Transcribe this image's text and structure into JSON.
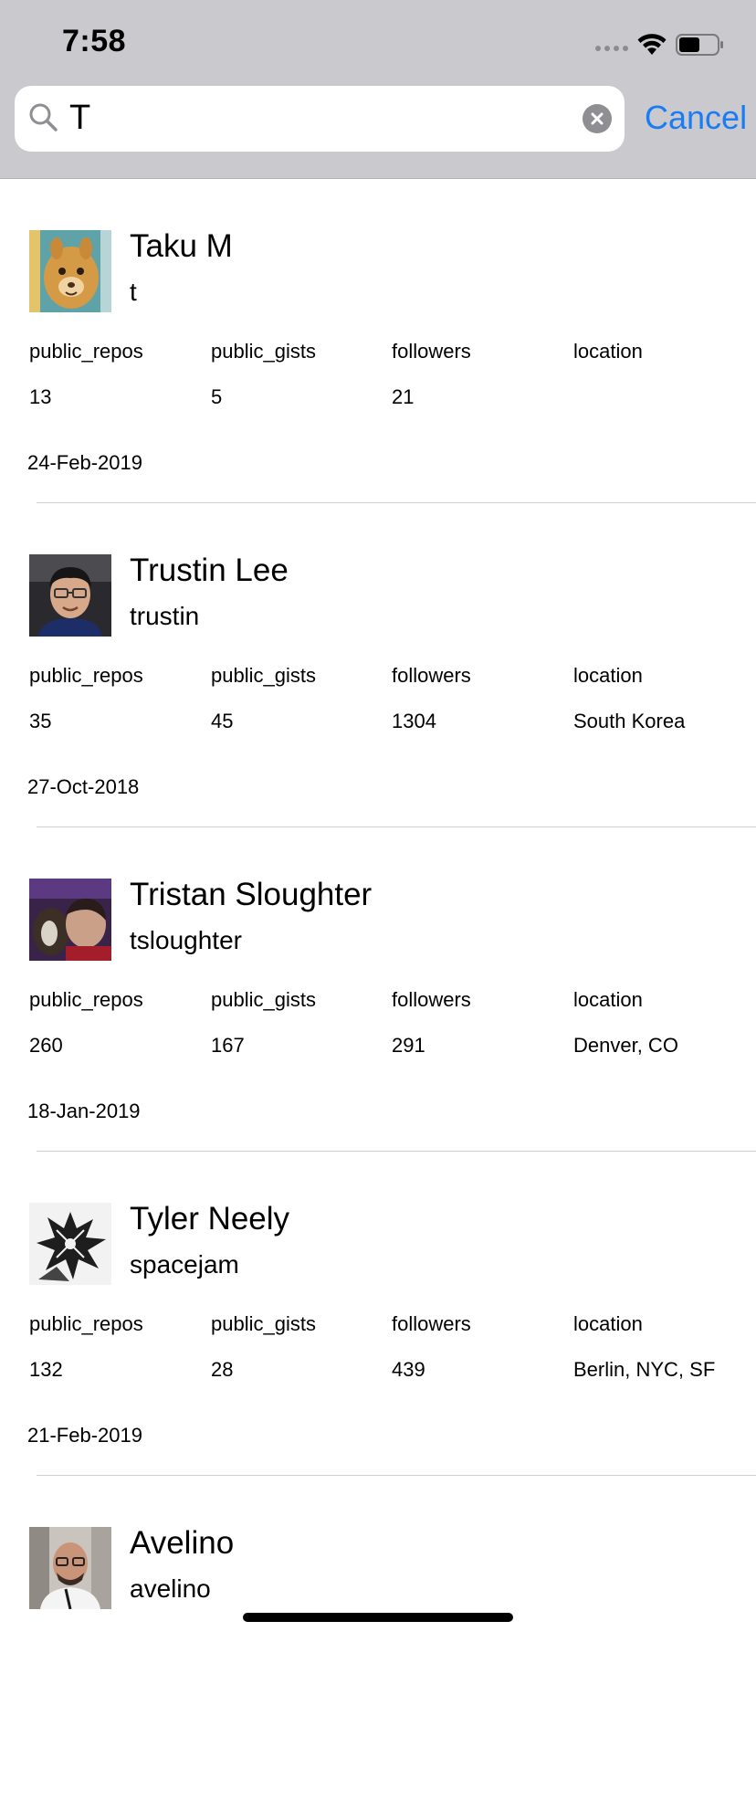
{
  "status_bar": {
    "time": "7:58"
  },
  "search": {
    "value": "T",
    "cancel_label": "Cancel"
  },
  "labels": {
    "public_repos": "public_repos",
    "public_gists": "public_gists",
    "followers": "followers",
    "location": "location"
  },
  "colors": {
    "accent": "#1a7cf4",
    "topbar": "#c9c9ce"
  },
  "users": [
    {
      "name": "Taku M",
      "login": "t",
      "public_repos": "13",
      "public_gists": "5",
      "followers": "21",
      "location": "",
      "date": "24-Feb-2019",
      "avatar": "alpaca-photo"
    },
    {
      "name": "Trustin Lee",
      "login": "trustin",
      "public_repos": "35",
      "public_gists": "45",
      "followers": "1304",
      "location": "South Korea",
      "date": "27-Oct-2018",
      "avatar": "man-with-glasses-photo"
    },
    {
      "name": "Tristan Sloughter",
      "login": "tsloughter",
      "public_repos": "260",
      "public_gists": "167",
      "followers": "291",
      "location": "Denver, CO",
      "date": "18-Jan-2019",
      "avatar": "man-with-dog-photo"
    },
    {
      "name": "Tyler Neely",
      "login": "spacejam",
      "public_repos": "132",
      "public_gists": "28",
      "followers": "439",
      "location": "Berlin, NYC, SF",
      "date": "21-Feb-2019",
      "avatar": "dragon-illustration"
    },
    {
      "name": "Avelino",
      "login": "avelino",
      "avatar": "bald-man-photo"
    }
  ]
}
